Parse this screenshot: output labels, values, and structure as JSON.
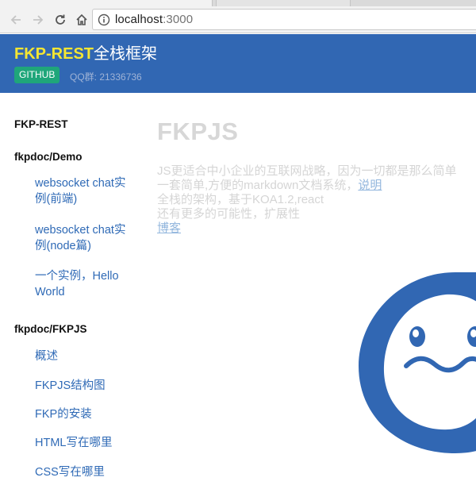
{
  "browser": {
    "url_host": "localhost",
    "url_port": ":3000"
  },
  "header": {
    "brand_name": "FKP-REST",
    "brand_sub": "全栈框架",
    "github_label": "GITHUB",
    "qq_text": "QQ群: 21336736",
    "colors": {
      "background": "#3167b3",
      "brand": "#f5e632",
      "github": "#1fa67a"
    }
  },
  "sidebar": {
    "top_title": "FKP-REST",
    "demo_title": "fkpdoc/Demo",
    "demo_items": [
      "websocket chat实例(前端)",
      "websocket chat实例(node篇)",
      "一个实例，Hello World"
    ],
    "fkpjs_title": "fkpdoc/FKPJS",
    "fkpjs_items": [
      "概述",
      "FKPJS结构图",
      "FKP的安装",
      "HTML写在哪里",
      "CSS写在哪里"
    ]
  },
  "main": {
    "title": "FKPJS",
    "line1": "JS更适合中小企业的互联网战略，因为一切都是那么简单",
    "line2": "一套简单,方便的markdown文档系统，",
    "line2_link": "说明",
    "line3": "全栈的架构，基于KOA1.2,react",
    "line4": "还有更多的可能性，扩展性",
    "blog_link": "博客"
  },
  "icons": [
    "back-arrow-icon",
    "forward-arrow-icon",
    "reload-icon",
    "home-icon",
    "info-icon",
    "mascot-logo"
  ]
}
